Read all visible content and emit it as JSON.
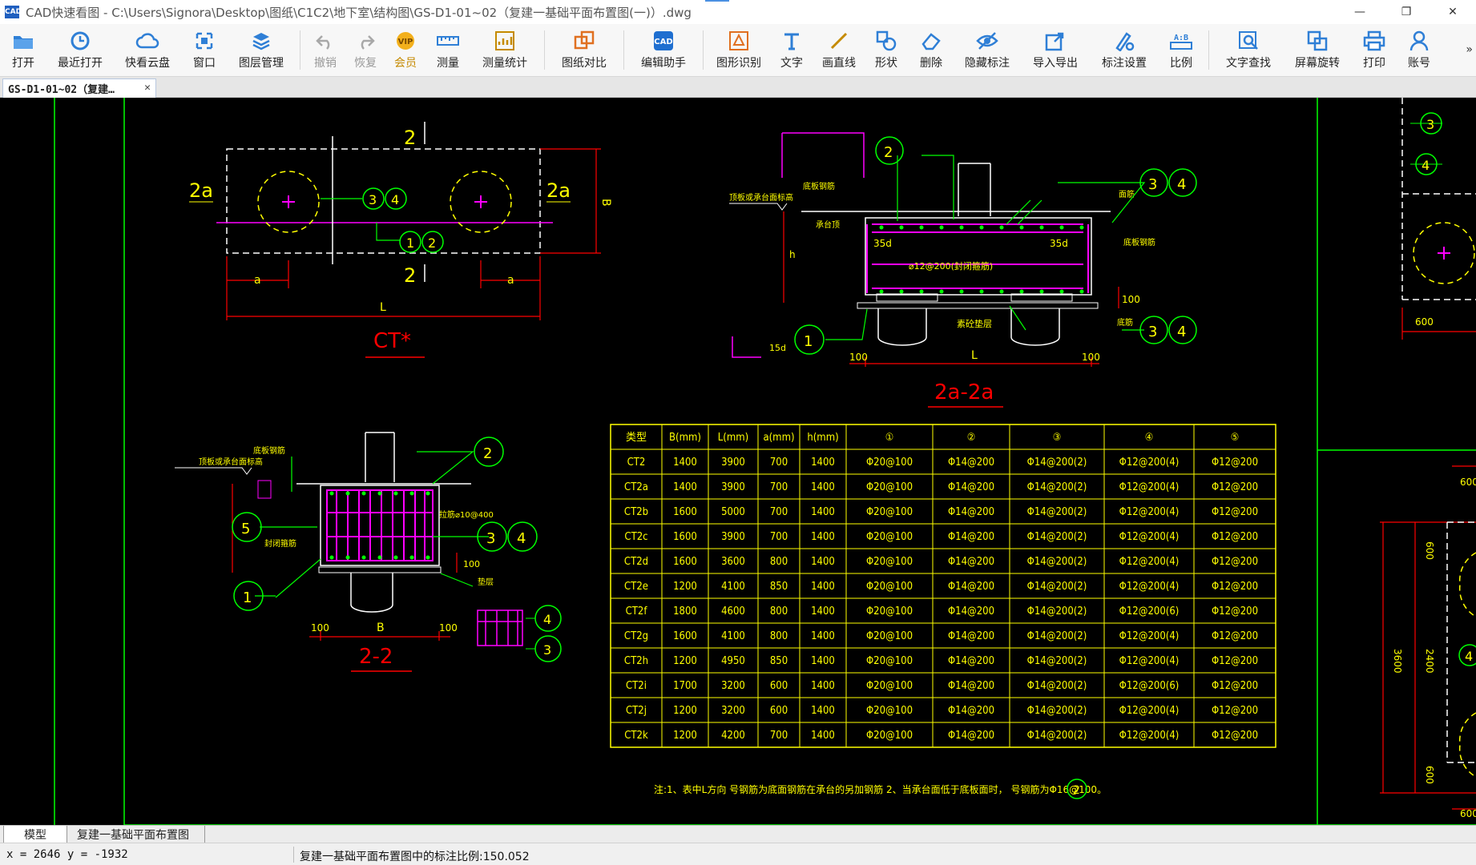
{
  "window": {
    "app_icon": "CAD",
    "title": "CAD快速看图 - C:\\Users\\Signora\\Desktop\\图纸\\C1C2\\地下室\\结构图\\GS-D1-01~02（复建一基础平面布置图(一)）.dwg",
    "minimize": "—",
    "restore": "❐",
    "close": "✕"
  },
  "toolbar": {
    "items": [
      {
        "label": "打开",
        "icon": "folder-open-icon"
      },
      {
        "label": "最近打开",
        "icon": "clock-icon"
      },
      {
        "label": "快看云盘",
        "icon": "cloud-icon"
      },
      {
        "label": "窗口",
        "icon": "window-icon"
      },
      {
        "label": "图层管理",
        "icon": "layers-icon"
      },
      {
        "label": "撤销",
        "icon": "undo-icon"
      },
      {
        "label": "恢复",
        "icon": "redo-icon"
      },
      {
        "label": "会员",
        "icon": "vip-icon"
      },
      {
        "label": "测量",
        "icon": "ruler-icon"
      },
      {
        "label": "测量统计",
        "icon": "measure-stats-icon"
      },
      {
        "label": "图纸对比",
        "icon": "compare-icon"
      },
      {
        "label": "编辑助手",
        "icon": "edit-assistant-icon"
      },
      {
        "label": "图形识别",
        "icon": "shape-recognition-icon"
      },
      {
        "label": "文字",
        "icon": "text-icon"
      },
      {
        "label": "画直线",
        "icon": "line-icon"
      },
      {
        "label": "形状",
        "icon": "shape-icon"
      },
      {
        "label": "删除",
        "icon": "eraser-icon"
      },
      {
        "label": "隐藏标注",
        "icon": "hide-eye-icon"
      },
      {
        "label": "导入导出",
        "icon": "import-export-icon"
      },
      {
        "label": "标注设置",
        "icon": "annotation-settings-icon"
      },
      {
        "label": "比例",
        "icon": "scale-icon"
      },
      {
        "label": "文字查找",
        "icon": "text-search-icon"
      },
      {
        "label": "屏幕旋转",
        "icon": "rotate-screen-icon"
      },
      {
        "label": "打印",
        "icon": "printer-icon"
      },
      {
        "label": "账号",
        "icon": "user-icon"
      }
    ],
    "more": "»"
  },
  "doc_tab": {
    "label": "GS-D1-01~02（复建…",
    "close": "✕"
  },
  "drawing": {
    "plan_view": {
      "title": "CT*",
      "section_mark": "2",
      "side_mark": "2a",
      "dim_a": "a",
      "dim_L": "L",
      "dim_B": "B",
      "callouts": [
        "3",
        "4",
        "1",
        "2"
      ]
    },
    "section_2a": {
      "title": "2a-2a",
      "dim_L": "L",
      "dim_100": "100",
      "dim_35d": "35d",
      "rebar_note": "⌀12@200(封闭箍筋)",
      "dim_h": "h",
      "dim_15d": "15d",
      "labels": [
        "顶板或承台面标高",
        "底板钢筋",
        "面筋",
        "底板钢筋",
        "素砼垫层",
        "底筋",
        "承台顶"
      ],
      "callouts": [
        "2",
        "3",
        "4",
        "1",
        "3",
        "4"
      ]
    },
    "section_22": {
      "title": "2-2",
      "dim_B": "B",
      "dim_100": "100",
      "labels": [
        "顶板或承台面标高",
        "底板钢筋",
        "拉筋⌀10@400",
        "封闭箍筋",
        "垫层"
      ],
      "callouts": [
        "2",
        "5",
        "3",
        "4",
        "1",
        "4",
        "3"
      ]
    },
    "table": {
      "headers": [
        "类型",
        "B(mm)",
        "L(mm)",
        "a(mm)",
        "h(mm)",
        "①",
        "②",
        "③",
        "④",
        "⑤"
      ],
      "rows": [
        [
          "CT2",
          "1400",
          "3900",
          "700",
          "1400",
          "Φ20@100",
          "Φ14@200",
          "Φ14@200(2)",
          "Φ12@200(4)",
          "Φ12@200"
        ],
        [
          "CT2a",
          "1400",
          "3900",
          "700",
          "1400",
          "Φ20@100",
          "Φ14@200",
          "Φ14@200(2)",
          "Φ12@200(4)",
          "Φ12@200"
        ],
        [
          "CT2b",
          "1600",
          "5000",
          "700",
          "1400",
          "Φ20@100",
          "Φ14@200",
          "Φ14@200(2)",
          "Φ12@200(4)",
          "Φ12@200"
        ],
        [
          "CT2c",
          "1600",
          "3900",
          "700",
          "1400",
          "Φ20@100",
          "Φ14@200",
          "Φ14@200(2)",
          "Φ12@200(4)",
          "Φ12@200"
        ],
        [
          "CT2d",
          "1600",
          "3600",
          "800",
          "1400",
          "Φ20@100",
          "Φ14@200",
          "Φ14@200(2)",
          "Φ12@200(4)",
          "Φ12@200"
        ],
        [
          "CT2e",
          "1200",
          "4100",
          "850",
          "1400",
          "Φ20@100",
          "Φ14@200",
          "Φ14@200(2)",
          "Φ12@200(4)",
          "Φ12@200"
        ],
        [
          "CT2f",
          "1800",
          "4600",
          "800",
          "1400",
          "Φ20@100",
          "Φ14@200",
          "Φ14@200(2)",
          "Φ12@200(6)",
          "Φ12@200"
        ],
        [
          "CT2g",
          "1600",
          "4100",
          "800",
          "1400",
          "Φ20@100",
          "Φ14@200",
          "Φ14@200(2)",
          "Φ12@200(4)",
          "Φ12@200"
        ],
        [
          "CT2h",
          "1200",
          "4950",
          "850",
          "1400",
          "Φ20@100",
          "Φ14@200",
          "Φ14@200(2)",
          "Φ12@200(4)",
          "Φ12@200"
        ],
        [
          "CT2i",
          "1700",
          "3200",
          "600",
          "1400",
          "Φ20@100",
          "Φ14@200",
          "Φ14@200(2)",
          "Φ12@200(6)",
          "Φ12@200"
        ],
        [
          "CT2j",
          "1200",
          "3200",
          "600",
          "1400",
          "Φ20@100",
          "Φ14@200",
          "Φ14@200(2)",
          "Φ12@200(4)",
          "Φ12@200"
        ],
        [
          "CT2k",
          "1200",
          "4200",
          "700",
          "1400",
          "Φ20@100",
          "Φ14@200",
          "Φ14@200(2)",
          "Φ12@200(4)",
          "Φ12@200"
        ]
      ]
    },
    "note": "注:1、表中L方向 号钢筋为底面钢筋在承台的另加钢筋 2、当承台面低于底板面时， 号钢筋为Φ16@100。",
    "note_callout": "2",
    "right_panel": {
      "dims": [
        "600",
        "600",
        "600",
        "2400",
        "3600",
        "600",
        "600"
      ],
      "callouts": [
        "3",
        "4",
        "4"
      ]
    }
  },
  "layout_tabs": {
    "model": "模型",
    "layout1": "复建一基础平面布置图"
  },
  "status": {
    "coords": "x = 2646 y = -1932",
    "scale": "复建一基础平面布置图中的标注比例:150.052"
  }
}
